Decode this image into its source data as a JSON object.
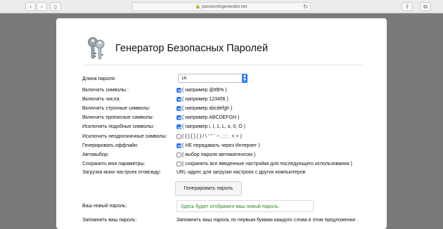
{
  "browser": {
    "url": "passwordsgenerator.net",
    "back_glyph": "‹",
    "forward_glyph": "›",
    "reload_glyph": "↻",
    "share_glyph": "⇪",
    "tabs_glyph": "⧉",
    "sidebar_glyph": "▯",
    "lock_glyph": "🔒"
  },
  "header": {
    "title": "Генератор Безопасных Паролей"
  },
  "form": {
    "length": {
      "label": "Длина пароля:",
      "value": "16"
    },
    "options": [
      {
        "label": "Включить символы :",
        "checked": true,
        "text": "( например @#$% )"
      },
      {
        "label": "Включить числа:",
        "checked": true,
        "text": "( например 123456 )"
      },
      {
        "label": "Включить строчные символы:",
        "checked": true,
        "text": "( например abcdefgh )"
      },
      {
        "label": "Включить прописные символы:",
        "checked": true,
        "text": "( например ABCDEFGH )"
      },
      {
        "label": "Исключить подобные символы:",
        "checked": true,
        "text": "( например i, l, 1, L, o, 0, O )"
      },
      {
        "label": "Исключить неоднозначные символы:",
        "checked": false,
        "text": "( { } [ ] ( ) / \\ ' \" ` ~ , ; : . < > )"
      },
      {
        "label": "Генерировать оффлайн:",
        "checked": true,
        "text": "( НЕ передавать через Интернет )"
      },
      {
        "label": "Автовыбор:",
        "checked": false,
        "text": "( выбор пароля автоматически )"
      },
      {
        "label": "Сохранить мои параметры:",
        "checked": false,
        "text": "( сохранить все введенные настройки для последующего использования )"
      }
    ],
    "load_settings": {
      "label": "Загрузка моих настроек отовсюду:",
      "text": "URL-адрес для загрузки настроек с других компьютеров"
    },
    "generate_button": "Генерировать пароль",
    "new_password": {
      "label": "Ваш новый пароль:",
      "placeholder": "Здесь будет отображен ваш новый пароль."
    },
    "remember": {
      "label": "Запомнить ваш пароль:",
      "text": "Запомнить ваш пароль по первым буквам каждого слова в этом предложении ."
    }
  },
  "colors": {
    "accent": "#2f7cf6",
    "result_text": "#2e8b2e"
  }
}
